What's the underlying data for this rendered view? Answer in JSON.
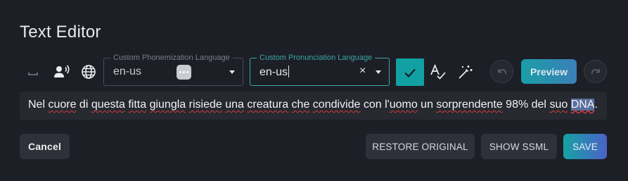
{
  "window": {
    "title": "Text Editor"
  },
  "toolbar": {
    "icons": [
      "space-icon",
      "voice-icon",
      "globe-icon",
      "spellcheck-icon",
      "magic-wand-icon",
      "undo-icon",
      "redo-icon",
      "check-icon"
    ],
    "phonemization": {
      "legend": "Custom Phonemization Language",
      "value": "en-us"
    },
    "pronunciation": {
      "legend": "Custom Pronunciation Language",
      "value": "en-us",
      "clear": "×"
    },
    "preview_label": "Preview"
  },
  "editor": {
    "text_parts": [
      "Nel ",
      "cuore",
      " di ",
      "questa",
      " ",
      "fitta",
      " ",
      "giungla",
      " ",
      "risiede",
      " ",
      "una",
      " ",
      "creatura",
      " ",
      "che",
      " ",
      "condivide",
      " con l'",
      "uomo",
      " un ",
      "sorprendente",
      " 98% del ",
      "suo",
      " ",
      "DNA",
      "."
    ]
  },
  "actions": {
    "cancel": "Cancel",
    "restore": "RESTORE ORIGINAL",
    "show_ssml": "SHOW SSML",
    "save": "SAVE"
  },
  "colors": {
    "background": "#1d1f26",
    "accent": "#12a0a3",
    "spellcheck": "#d43a3a",
    "selection": "#5b6f9e"
  }
}
